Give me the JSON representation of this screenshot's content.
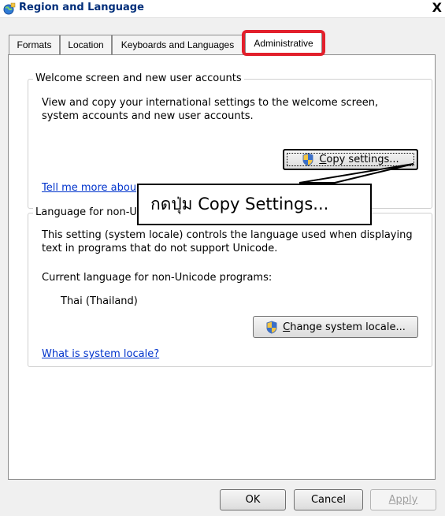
{
  "window": {
    "title": "Region and Language",
    "close_label": "X"
  },
  "tabs": [
    {
      "label": "Formats"
    },
    {
      "label": "Location"
    },
    {
      "label": "Keyboards and Languages"
    },
    {
      "label": "Administrative"
    }
  ],
  "welcome_group": {
    "legend": "Welcome screen and new user accounts",
    "description": "View and copy your international settings to the welcome screen, system accounts and new user accounts.",
    "copy_button": {
      "accel": "C",
      "rest": "opy settings..."
    },
    "link": "Tell me more abou"
  },
  "locale_group": {
    "legend": "Language for non-U",
    "description": "This setting (system locale) controls the language used when displaying text in programs that do not support Unicode.",
    "current_label": "Current language for non-Unicode programs:",
    "current_value": "Thai (Thailand)",
    "change_button": {
      "accel": "C",
      "rest": "hange system locale..."
    },
    "link": "What is system locale?"
  },
  "callout": {
    "text": "กดปุ่ม Copy Settings..."
  },
  "buttons": {
    "ok": "OK",
    "cancel": "Cancel",
    "apply": "Apply"
  },
  "colors": {
    "highlight": "#e2202c",
    "link": "#0033cc",
    "title": "#002e7a"
  }
}
